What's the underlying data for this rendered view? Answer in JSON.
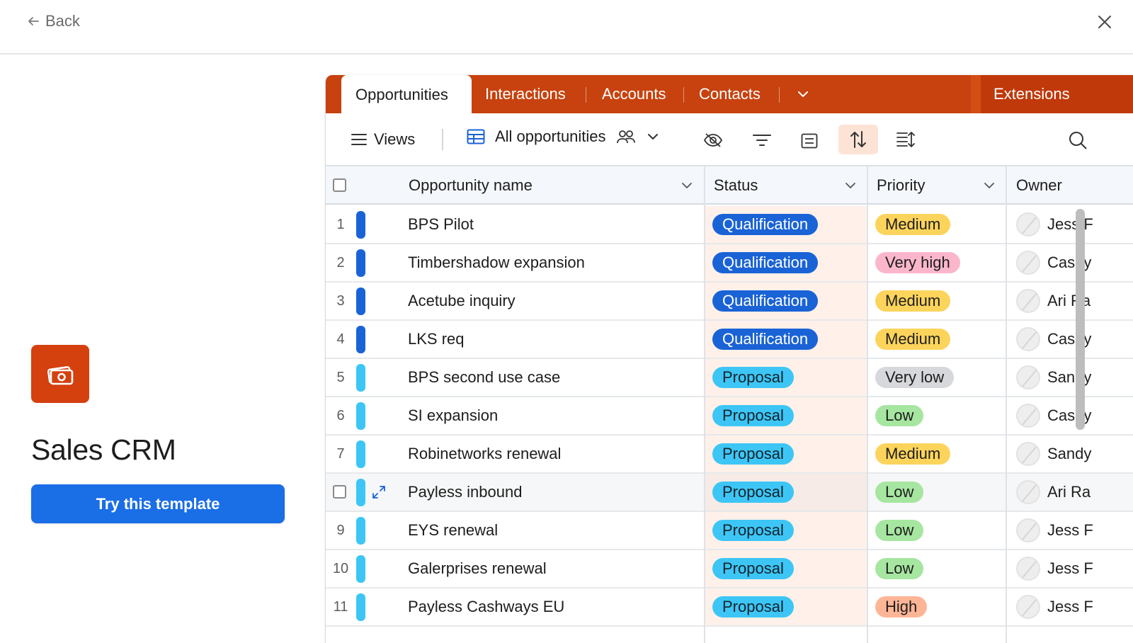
{
  "topbar": {
    "back_label": "Back"
  },
  "template": {
    "title": "Sales CRM",
    "try_button": "Try this template"
  },
  "tabs": [
    {
      "label": "Opportunities",
      "active": true
    },
    {
      "label": "Interactions"
    },
    {
      "label": "Accounts"
    },
    {
      "label": "Contacts"
    }
  ],
  "extensions_label": "Extensions",
  "toolbar": {
    "views_label": "Views",
    "view_name": "All opportunities"
  },
  "columns": {
    "name": "Opportunity name",
    "status": "Status",
    "priority": "Priority",
    "owner": "Owner"
  },
  "rows": [
    {
      "num": "1",
      "name": "BPS Pilot",
      "status": "Qualification",
      "priority": "Medium",
      "owner": "Jess F",
      "bar": "#1a63d6"
    },
    {
      "num": "2",
      "name": "Timbershadow expansion",
      "status": "Qualification",
      "priority": "Very high",
      "owner": "Casey",
      "bar": "#1a63d6"
    },
    {
      "num": "3",
      "name": "Acetube inquiry",
      "status": "Qualification",
      "priority": "Medium",
      "owner": "Ari Ra",
      "bar": "#1a63d6"
    },
    {
      "num": "4",
      "name": "LKS req",
      "status": "Qualification",
      "priority": "Medium",
      "owner": "Casey",
      "bar": "#1a63d6"
    },
    {
      "num": "5",
      "name": "BPS second use case",
      "status": "Proposal",
      "priority": "Very low",
      "owner": "Sandy",
      "bar": "#3dc6f5"
    },
    {
      "num": "6",
      "name": "SI expansion",
      "status": "Proposal",
      "priority": "Low",
      "owner": "Casey",
      "bar": "#3dc6f5"
    },
    {
      "num": "7",
      "name": "Robinetworks renewal",
      "status": "Proposal",
      "priority": "Medium",
      "owner": "Sandy",
      "bar": "#3dc6f5"
    },
    {
      "num": "",
      "name": "Payless inbound",
      "status": "Proposal",
      "priority": "Low",
      "owner": "Ari Ra",
      "bar": "#3dc6f5"
    },
    {
      "num": "9",
      "name": "EYS renewal",
      "status": "Proposal",
      "priority": "Low",
      "owner": "Jess F",
      "bar": "#3dc6f5"
    },
    {
      "num": "10",
      "name": "Galerprises renewal",
      "status": "Proposal",
      "priority": "Low",
      "owner": "Jess F",
      "bar": "#3dc6f5"
    },
    {
      "num": "11",
      "name": "Payless Cashways EU",
      "status": "Proposal",
      "priority": "High",
      "owner": "Jess F",
      "bar": "#3dc6f5"
    }
  ],
  "colors": {
    "brand": "#c7420e",
    "qualification": "#1a63d6",
    "proposal": "#3dc6f5",
    "medium": "#fcd45c",
    "very_high": "#fbb6cc",
    "very_low": "#d6d8dc",
    "low": "#a6e6a0",
    "high": "#fdb596"
  }
}
